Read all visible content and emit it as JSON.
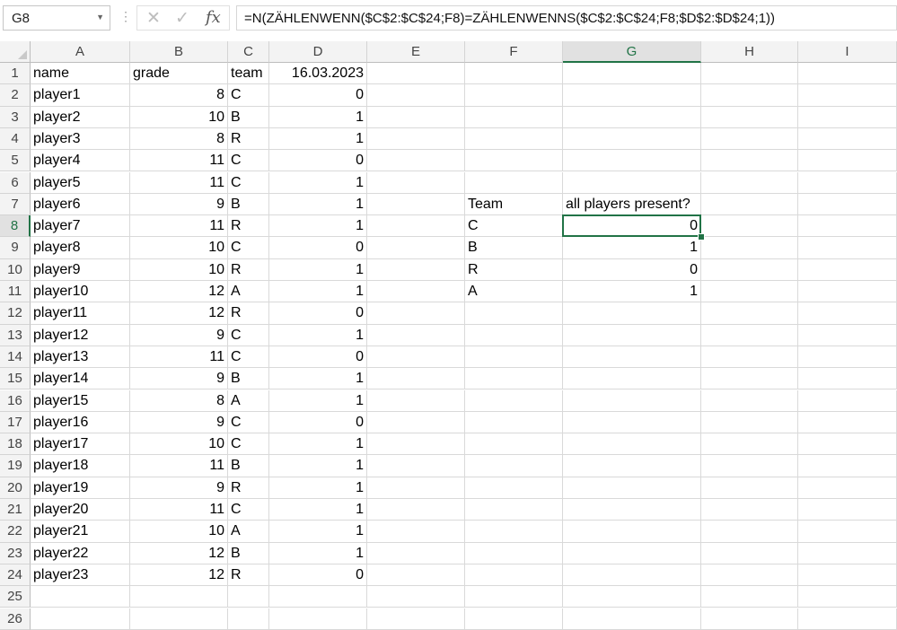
{
  "name_box": "G8",
  "formula": "=N(ZÄHLENWENN($C$2:$C$24;F8)=ZÄHLENWENNS($C$2:$C$24;F8;$D$2:$D$24;1))",
  "icons": {
    "cancel": "cancel-icon",
    "enter": "check-icon",
    "function": "fx-icon"
  },
  "columns": [
    "A",
    "B",
    "C",
    "D",
    "E",
    "F",
    "G",
    "H",
    "I"
  ],
  "rows": [
    "1",
    "2",
    "3",
    "4",
    "5",
    "6",
    "7",
    "8",
    "9",
    "10",
    "11",
    "12",
    "13",
    "14",
    "15",
    "16",
    "17",
    "18",
    "19",
    "20",
    "21",
    "22",
    "23",
    "24",
    "25",
    "26"
  ],
  "selected": {
    "col": "G",
    "row": "8"
  },
  "header": {
    "name": "name",
    "grade": "grade",
    "team": "team",
    "date": "16.03.2023"
  },
  "players": [
    {
      "name": "player1",
      "grade": "8",
      "team": "C",
      "present": "0"
    },
    {
      "name": "player2",
      "grade": "10",
      "team": "B",
      "present": "1"
    },
    {
      "name": "player3",
      "grade": "8",
      "team": "R",
      "present": "1"
    },
    {
      "name": "player4",
      "grade": "11",
      "team": "C",
      "present": "0"
    },
    {
      "name": "player5",
      "grade": "11",
      "team": "C",
      "present": "1"
    },
    {
      "name": "player6",
      "grade": "9",
      "team": "B",
      "present": "1"
    },
    {
      "name": "player7",
      "grade": "11",
      "team": "R",
      "present": "1"
    },
    {
      "name": "player8",
      "grade": "10",
      "team": "C",
      "present": "0"
    },
    {
      "name": "player9",
      "grade": "10",
      "team": "R",
      "present": "1"
    },
    {
      "name": "player10",
      "grade": "12",
      "team": "A",
      "present": "1"
    },
    {
      "name": "player11",
      "grade": "12",
      "team": "R",
      "present": "0"
    },
    {
      "name": "player12",
      "grade": "9",
      "team": "C",
      "present": "1"
    },
    {
      "name": "player13",
      "grade": "11",
      "team": "C",
      "present": "0"
    },
    {
      "name": "player14",
      "grade": "9",
      "team": "B",
      "present": "1"
    },
    {
      "name": "player15",
      "grade": "8",
      "team": "A",
      "present": "1"
    },
    {
      "name": "player16",
      "grade": "9",
      "team": "C",
      "present": "0"
    },
    {
      "name": "player17",
      "grade": "10",
      "team": "C",
      "present": "1"
    },
    {
      "name": "player18",
      "grade": "11",
      "team": "B",
      "present": "1"
    },
    {
      "name": "player19",
      "grade": "9",
      "team": "R",
      "present": "1"
    },
    {
      "name": "player20",
      "grade": "11",
      "team": "C",
      "present": "1"
    },
    {
      "name": "player21",
      "grade": "10",
      "team": "A",
      "present": "1"
    },
    {
      "name": "player22",
      "grade": "12",
      "team": "B",
      "present": "1"
    },
    {
      "name": "player23",
      "grade": "12",
      "team": "R",
      "present": "0"
    }
  ],
  "summary": {
    "team_header": "Team",
    "present_header": "all players present?",
    "rows": [
      {
        "team": "C",
        "value": "0"
      },
      {
        "team": "B",
        "value": "1"
      },
      {
        "team": "R",
        "value": "0"
      },
      {
        "team": "A",
        "value": "1"
      }
    ]
  },
  "colors": {
    "accent": "#217346"
  }
}
